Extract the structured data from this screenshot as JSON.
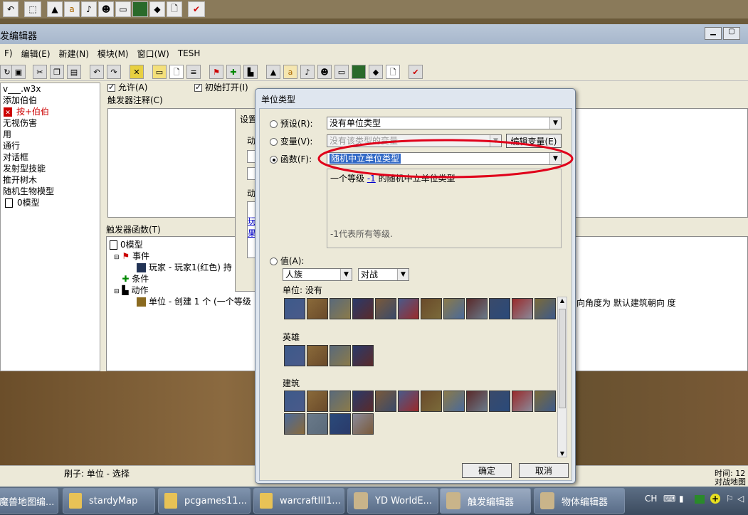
{
  "top_toolbar": {
    "icon_names": [
      "undo-icon",
      "select-icon",
      "terrain-icon",
      "doodad-icon",
      "sound-icon",
      "unit-icon",
      "item-icon",
      "map-icon",
      "import-icon",
      "new-icon",
      "test-icon"
    ]
  },
  "window": {
    "title": "发编辑器"
  },
  "menu": [
    "F)",
    "编辑(E)",
    "新建(N)",
    "模块(M)",
    "窗口(W)",
    "TESH"
  ],
  "tree": {
    "items": [
      "v___.w3x",
      "添加伯伯",
      "按+伯伯",
      "无视伤害",
      "用",
      "通行",
      "对话框",
      "发射型技能",
      "推开树木",
      "随机生物模型",
      "0模型"
    ],
    "selected_index": 2
  },
  "trigger_panel": {
    "enabled_label": "允许(A)",
    "initially_on_label": "初始打开(I)",
    "comment_label": "触发器注释(C)",
    "functions_label": "触发器函数(T)",
    "function_tree": {
      "root": "0模型",
      "events": "事件",
      "event_item": "玩家 - 玩家1(红色) 持",
      "conditions": "条件",
      "actions": "动作",
      "action_item": "单位 - 创建 1 个 (一个等级",
      "action_tail": "向角度为 默认建筑朝向 度"
    }
  },
  "settings_dialog": {
    "title": "设置",
    "labels": [
      "动",
      "动"
    ],
    "links": [
      "玩",
      "果"
    ]
  },
  "unit_type_dialog": {
    "title": "单位类型",
    "preset_label": "预设(R):",
    "preset_value": "没有单位类型",
    "variable_label": "变量(V):",
    "variable_value": "没有该类型的变量",
    "edit_variable_button": "编辑变量(E)",
    "function_label": "函数(F):",
    "function_value": "随机中立单位类型",
    "function_desc_parts": [
      "一个等级 ",
      "-1",
      " 的随机中立单位类型"
    ],
    "function_note": "-1代表所有等级.",
    "value_label": "值(A):",
    "race_value": "人族",
    "mode_value": "对战",
    "units_label": "单位: 没有",
    "heroes_label": "英雄",
    "buildings_label": "建筑",
    "ok_button": "确定",
    "cancel_button": "取消",
    "units_count": 12,
    "heroes_count": 4,
    "buildings_count": 16,
    "highlight_color": "#e0001a"
  },
  "status": {
    "brush": "刷子: 单位 - 选择",
    "time": "时间: 12",
    "map": "对战地图"
  },
  "taskbar": {
    "items": [
      "魔兽地图编...",
      "stardyMap",
      "pcgames11...",
      "warcraftIII1...",
      "YD WorldE...",
      "触发编辑器",
      "物体编辑器"
    ],
    "lang": "CH"
  }
}
